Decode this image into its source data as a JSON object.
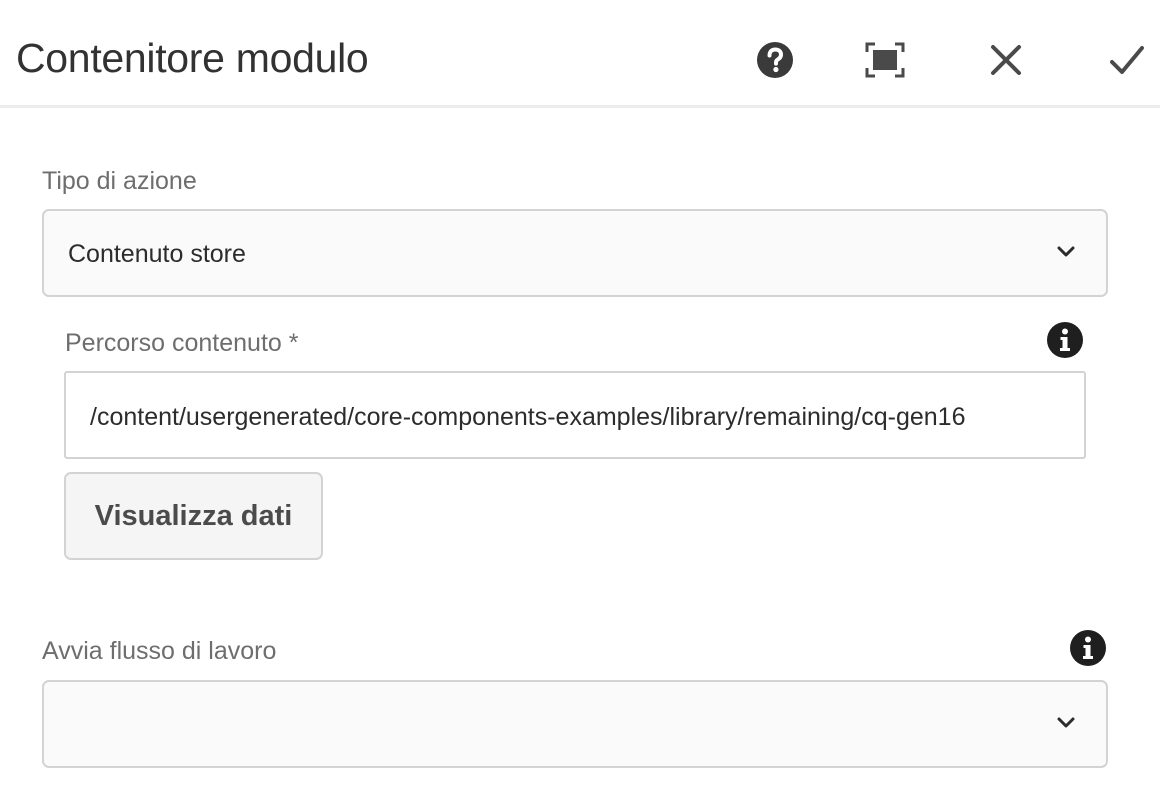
{
  "dialog": {
    "title": "Contenitore modulo",
    "actions": {
      "help": "help-icon",
      "fullscreen": "fullscreen-icon",
      "close": "close-icon",
      "done": "checkmark-icon"
    }
  },
  "form": {
    "action_type": {
      "label": "Tipo di azione",
      "selected": "Contenuto store"
    },
    "content_path": {
      "label": "Percorso contenuto *",
      "value": "/content/usergenerated/core-components-examples/library/remaining/cq-gen16"
    },
    "view_data_button": "Visualizza dati",
    "start_workflow": {
      "label": "Avvia flusso di lavoro",
      "selected": ""
    }
  },
  "colors": {
    "header_border": "#ececec",
    "field_border": "#d3d3d3",
    "label_text": "#6e6e6e",
    "icon": "#2c2c2c"
  }
}
